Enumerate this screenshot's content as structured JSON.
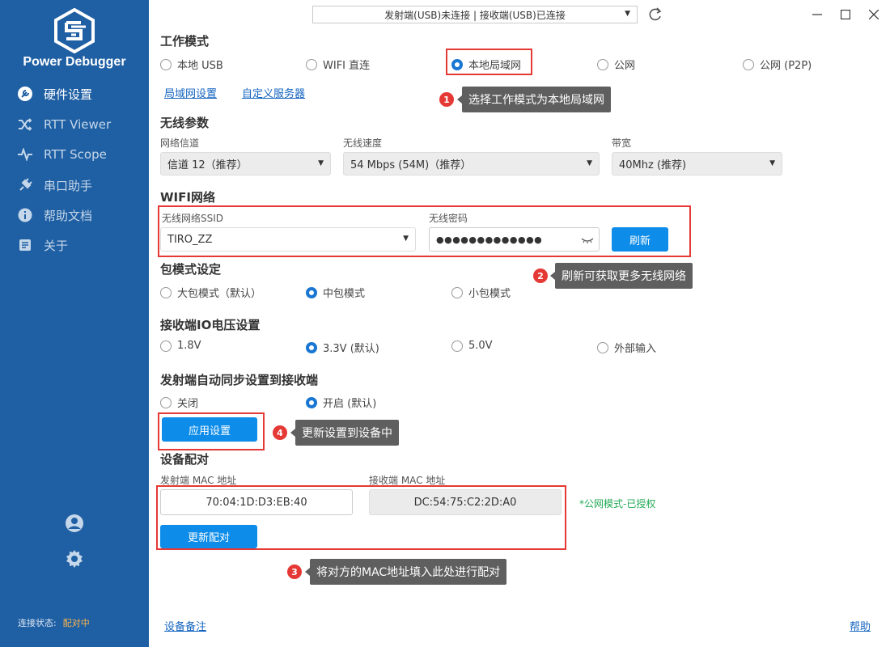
{
  "app": {
    "title": "Power Debugger",
    "connection_label": "连接状态:",
    "connection_value": "配对中"
  },
  "nav": {
    "items": [
      {
        "label": "硬件设置",
        "icon": "wrench-icon",
        "active": true
      },
      {
        "label": "RTT Viewer",
        "icon": "shuffle-icon",
        "active": false
      },
      {
        "label": "RTT Scope",
        "icon": "pulse-icon",
        "active": false
      },
      {
        "label": "串口助手",
        "icon": "plug-icon",
        "active": false
      },
      {
        "label": "帮助文档",
        "icon": "info-icon",
        "active": false
      },
      {
        "label": "关于",
        "icon": "document-icon",
        "active": false
      }
    ]
  },
  "topbar": {
    "device_status": "发射端(USB)未连接 | 接收端(USB)已连接"
  },
  "work_mode": {
    "title": "工作模式",
    "options": [
      "本地 USB",
      "WIFI 直连",
      "本地局域网",
      "公网",
      "公网 (P2P)"
    ],
    "selected": "本地局域网",
    "link_lan": "局域网设置",
    "link_server": "自定义服务器"
  },
  "wireless": {
    "title": "无线参数",
    "channel_label": "网络信道",
    "channel_value": "信道 12（推荐）",
    "speed_label": "无线速度",
    "speed_value": "54 Mbps (54M)（推荐）",
    "bandwidth_label": "带宽",
    "bandwidth_value": "40Mhz (推荐)"
  },
  "wifi": {
    "title": "WIFI网络",
    "ssid_label": "无线网络SSID",
    "ssid_value": "TIRO_ZZ",
    "password_label": "无线密码",
    "password_value": "●●●●●●●●●●●●●",
    "refresh_button": "刷新"
  },
  "packet_mode": {
    "title": "包模式设定",
    "options": [
      "大包模式（默认）",
      "中包模式",
      "小包模式"
    ],
    "selected": "中包模式"
  },
  "io_voltage": {
    "title": "接收端IO电压设置",
    "options": [
      "1.8V",
      "3.3V (默认)",
      "5.0V",
      "外部输入"
    ],
    "selected": "3.3V (默认)"
  },
  "auto_sync": {
    "title": "发射端自动同步设置到接收端",
    "options": [
      "关闭",
      "开启 (默认)"
    ],
    "selected": "开启 (默认)",
    "apply_button": "应用设置"
  },
  "pairing": {
    "title": "设备配对",
    "tx_mac_label": "发射端 MAC 地址",
    "tx_mac_value": "70:04:1D:D3:EB:40",
    "rx_mac_label": "接收端 MAC 地址",
    "rx_mac_value": "DC:54:75:C2:2D:A0",
    "license_status": "*公网模式-已授权",
    "update_button": "更新配对"
  },
  "footer": {
    "device_note": "设备备注",
    "help": "帮助"
  },
  "annotations": [
    {
      "number": "1",
      "text": "选择工作模式为本地局域网"
    },
    {
      "number": "2",
      "text": "刷新可获取更多无线网络"
    },
    {
      "number": "3",
      "text": "将对方的MAC地址填入此处进行配对"
    },
    {
      "number": "4",
      "text": "更新设置到设备中"
    }
  ],
  "colors": {
    "sidebar": "#1f5fa3",
    "accent": "#0d8ce9",
    "annotation_red": "#e53935",
    "callout_bg": "#5f5f5f",
    "status_orange": "#ffb84d",
    "license_green": "#22aa55"
  }
}
